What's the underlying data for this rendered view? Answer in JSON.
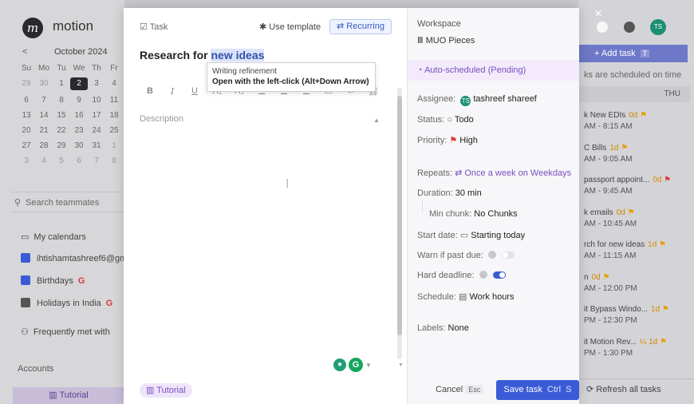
{
  "app": {
    "brand": "motion",
    "logo_letter": "m"
  },
  "calendar": {
    "prev": "<",
    "month": "October 2024",
    "weekdays": [
      "Su",
      "Mo",
      "Tu",
      "We",
      "Th",
      "Fr"
    ],
    "rows": [
      [
        "29",
        "30",
        "1",
        "2",
        "3",
        "4"
      ],
      [
        "6",
        "7",
        "8",
        "9",
        "10",
        "11"
      ],
      [
        "13",
        "14",
        "15",
        "16",
        "17",
        "18"
      ],
      [
        "20",
        "21",
        "22",
        "23",
        "24",
        "25"
      ],
      [
        "27",
        "28",
        "29",
        "30",
        "31",
        "1"
      ],
      [
        "3",
        "4",
        "5",
        "6",
        "7",
        "8"
      ]
    ],
    "selected": "2"
  },
  "sidebar": {
    "search_placeholder": "Search teammates",
    "my_calendars": "My calendars",
    "calendars": [
      {
        "label": "ihtishamtashreef6@gm",
        "color": "#3b5bd6"
      },
      {
        "label": "Birthdays",
        "badge": "G",
        "color": "#3b5bd6"
      },
      {
        "label": "Holidays in India",
        "badge": "G",
        "color": "#555555"
      }
    ],
    "frequently_met": "Frequently met with",
    "accounts": "Accounts",
    "tutorial": "Tutorial"
  },
  "right_bg": {
    "add_task": "+ Add task",
    "add_task_key": "T",
    "note": "ks are scheduled on time",
    "day": "THU",
    "events": [
      {
        "title": "k New EDIs",
        "dur": "0d",
        "time": "AM - 8:15 AM",
        "flag": "orange"
      },
      {
        "title": "C Bills",
        "dur": "1d",
        "time": "AM - 9:05 AM",
        "flag": "orange"
      },
      {
        "title": "passport appoint...",
        "dur": "0d",
        "time": "AM - 9:45 AM",
        "flag": "red"
      },
      {
        "title": "k emails",
        "dur": "0d",
        "time": "AM - 10:45 AM",
        "flag": "orange"
      },
      {
        "title": "rch for new ideas",
        "dur": "1d",
        "time": "AM - 11:15 AM",
        "flag": "orange"
      },
      {
        "title": "n",
        "dur": "0d",
        "time": "AM - 12:00 PM",
        "flag": "orange"
      },
      {
        "title": "it Bypass Windo...",
        "dur": "1d",
        "time": "PM - 12:30 PM",
        "flag": "orange"
      },
      {
        "title": "it Motion Rev...",
        "dur": "¼ 1d",
        "time": "PM - 1:30 PM",
        "flag": "orange"
      }
    ],
    "refresh": "Refresh all tasks",
    "avatar": "TS"
  },
  "task": {
    "type_label": "Task",
    "use_template": "Use template",
    "recurring": "Recurring",
    "title_plain": "Research for ",
    "title_highlight": "new ideas",
    "tooltip_line1": "Writing refinement",
    "tooltip_line2": "Open with the left-click (Alt+Down Arrow)",
    "toolbar": [
      "B",
      "I",
      "U",
      "H₁",
      "H₂",
      "☰",
      "☰",
      "☰",
      "▭",
      "‹/›",
      "⛓"
    ],
    "description_placeholder": "Description",
    "tutorial_chip": "Tutorial"
  },
  "details": {
    "workspace_label": "Workspace",
    "workspace_value": "MUO Pieces",
    "auto_scheduled": "Auto-scheduled (Pending)",
    "assignee_label": "Assignee:",
    "assignee_value": "tashreef shareef",
    "assignee_initials": "TS",
    "status_label": "Status:",
    "status_value": "Todo",
    "priority_label": "Priority:",
    "priority_value": "High",
    "repeats_label": "Repeats:",
    "repeats_value": "Once a week on Weekdays",
    "duration_label": "Duration:",
    "duration_value": "30 min",
    "min_chunk_label": "Min chunk:",
    "min_chunk_value": "No Chunks",
    "start_date_label": "Start date:",
    "start_date_value": "Starting today",
    "warn_label": "Warn if past due:",
    "warn_on": false,
    "hard_deadline_label": "Hard deadline:",
    "hard_deadline_on": true,
    "schedule_label": "Schedule:",
    "schedule_value": "Work hours",
    "labels_label": "Labels:",
    "labels_value": "None",
    "cancel": "Cancel",
    "cancel_key": "Esc",
    "save": "Save task",
    "save_key1": "Ctrl",
    "save_key2": "S"
  }
}
